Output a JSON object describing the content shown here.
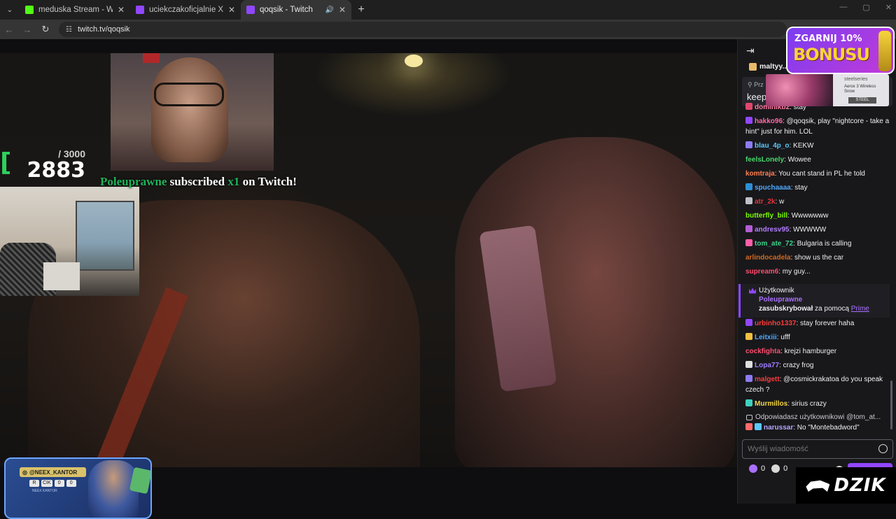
{
  "browser": {
    "tabs": [
      {
        "title": "meduska Stream - Watch Live o",
        "favicon_color": "#53fc18",
        "active": false
      },
      {
        "title": "uciekczakoficjalnie XD - Twitch",
        "favicon_color": "#9147ff",
        "active": false
      },
      {
        "title": "qoqsik - Twitch",
        "favicon_color": "#9147ff",
        "active": true
      }
    ],
    "new_tab": "+",
    "url": "twitch.tv/qoqsik"
  },
  "overlay": {
    "counter_goal": "/ 3000",
    "counter_value": "2883",
    "sub_alert": {
      "name": "Poleuprawne",
      "text1": "subscribed",
      "mult": "x1",
      "text2": "on Twitch!"
    },
    "promo": {
      "handle": "@NEEX_KANTOR",
      "chips": [
        "R",
        "CIK",
        "0",
        "0"
      ],
      "tagline": "NEEX KANTOR"
    }
  },
  "chat": {
    "pinned_user": "maltyy...",
    "pinned_label": "Prz",
    "pinned_text": "keep",
    "messages": [
      {
        "user": "dominikb2",
        "color": "#ff7aa0",
        "text": ": stay",
        "badge": "#e0466d"
      },
      {
        "user": "hakko96",
        "color": "#ff6aa6",
        "text": ": @qoqsik, play \"nightcore - take a hint\" just for him. LOL",
        "badge": "#9147ff"
      },
      {
        "user": "blau_4p_o",
        "color": "#5ac8fa",
        "text": ": KEKW",
        "badge": "#8c7cf2"
      },
      {
        "user": "feelsLonely",
        "color": "#49d66a",
        "text": ": Wowee",
        "badge": ""
      },
      {
        "user": "komtraja",
        "color": "#ff7f50",
        "text": ": You cant stand in PL he told",
        "badge": ""
      },
      {
        "user": "spuchaaaa",
        "color": "#4fa8ff",
        "text": ": stay",
        "badge": "#2e8fd6"
      },
      {
        "user": "atr_2k",
        "color": "#e0353a",
        "text": ": w",
        "badge": "#c0c0c8"
      },
      {
        "user": "butterfly_bill",
        "color": "#7cfc00",
        "text": ": Wwwwwww",
        "badge": ""
      },
      {
        "user": "andresv95",
        "color": "#b27cff",
        "text": ": WWWWW",
        "badge": "#b45cd6"
      },
      {
        "user": "tom_ate_72",
        "color": "#3ed18a",
        "text": ": Bulgaria is calling",
        "badge": "#ff5fa8"
      },
      {
        "user": "arlindocadela",
        "color": "#d2691e",
        "text": ": show us the car",
        "badge": ""
      },
      {
        "user": "supream6",
        "color": "#ff4d6d",
        "text": ": my guy...",
        "badge": ""
      }
    ],
    "sub_notice": {
      "user_label": "Użytkownik",
      "name": "Poleuprawne",
      "action": "zasubskrybował",
      "via": " za pomocą ",
      "prime": "Prime"
    },
    "messages2": [
      {
        "user": "urbinho1337",
        "color": "#ff3b3b",
        "text": ": stay forever haha",
        "badge": "#9147ff"
      },
      {
        "user": "Leitxiii",
        "color": "#4fa8ff",
        "text": ": ufff",
        "badge": "#f0c040"
      },
      {
        "user": "cockfighta",
        "color": "#ff4d6d",
        "text": ": krejzi hamburger",
        "badge": ""
      },
      {
        "user": "Lopa77",
        "color": "#9e7cff",
        "text": ": crazy frog",
        "badge": "#dedede"
      },
      {
        "user": "malgett",
        "color": "#ff3b3b",
        "text": ": @cosmickrakatoa do you speak czech ?",
        "badge": "#8c7cf2"
      },
      {
        "user": "Murmillos",
        "color": "#f5d742",
        "text": ": sirius crazy",
        "badge": "#3ed1c0"
      }
    ],
    "reply_to": "Odpowiadasz użytkownikowi @tom_at...",
    "last_msg": {
      "user": "narussar",
      "color": "#b7a6ff",
      "text": ": No \"Montebadword\"",
      "badge": "#ff6a6a"
    },
    "input_placeholder": "Wyślij wiadomość",
    "points": [
      "0",
      "0"
    ]
  },
  "ads": {
    "bonus_line1": "ZGARNIJ 10%",
    "bonus_line2": "BONUSU",
    "steel_brand": "steelseries",
    "steel_product": "Aerox 3 Wireless Snow",
    "steel_cta": "STEEL",
    "dzik": "DZIK"
  }
}
